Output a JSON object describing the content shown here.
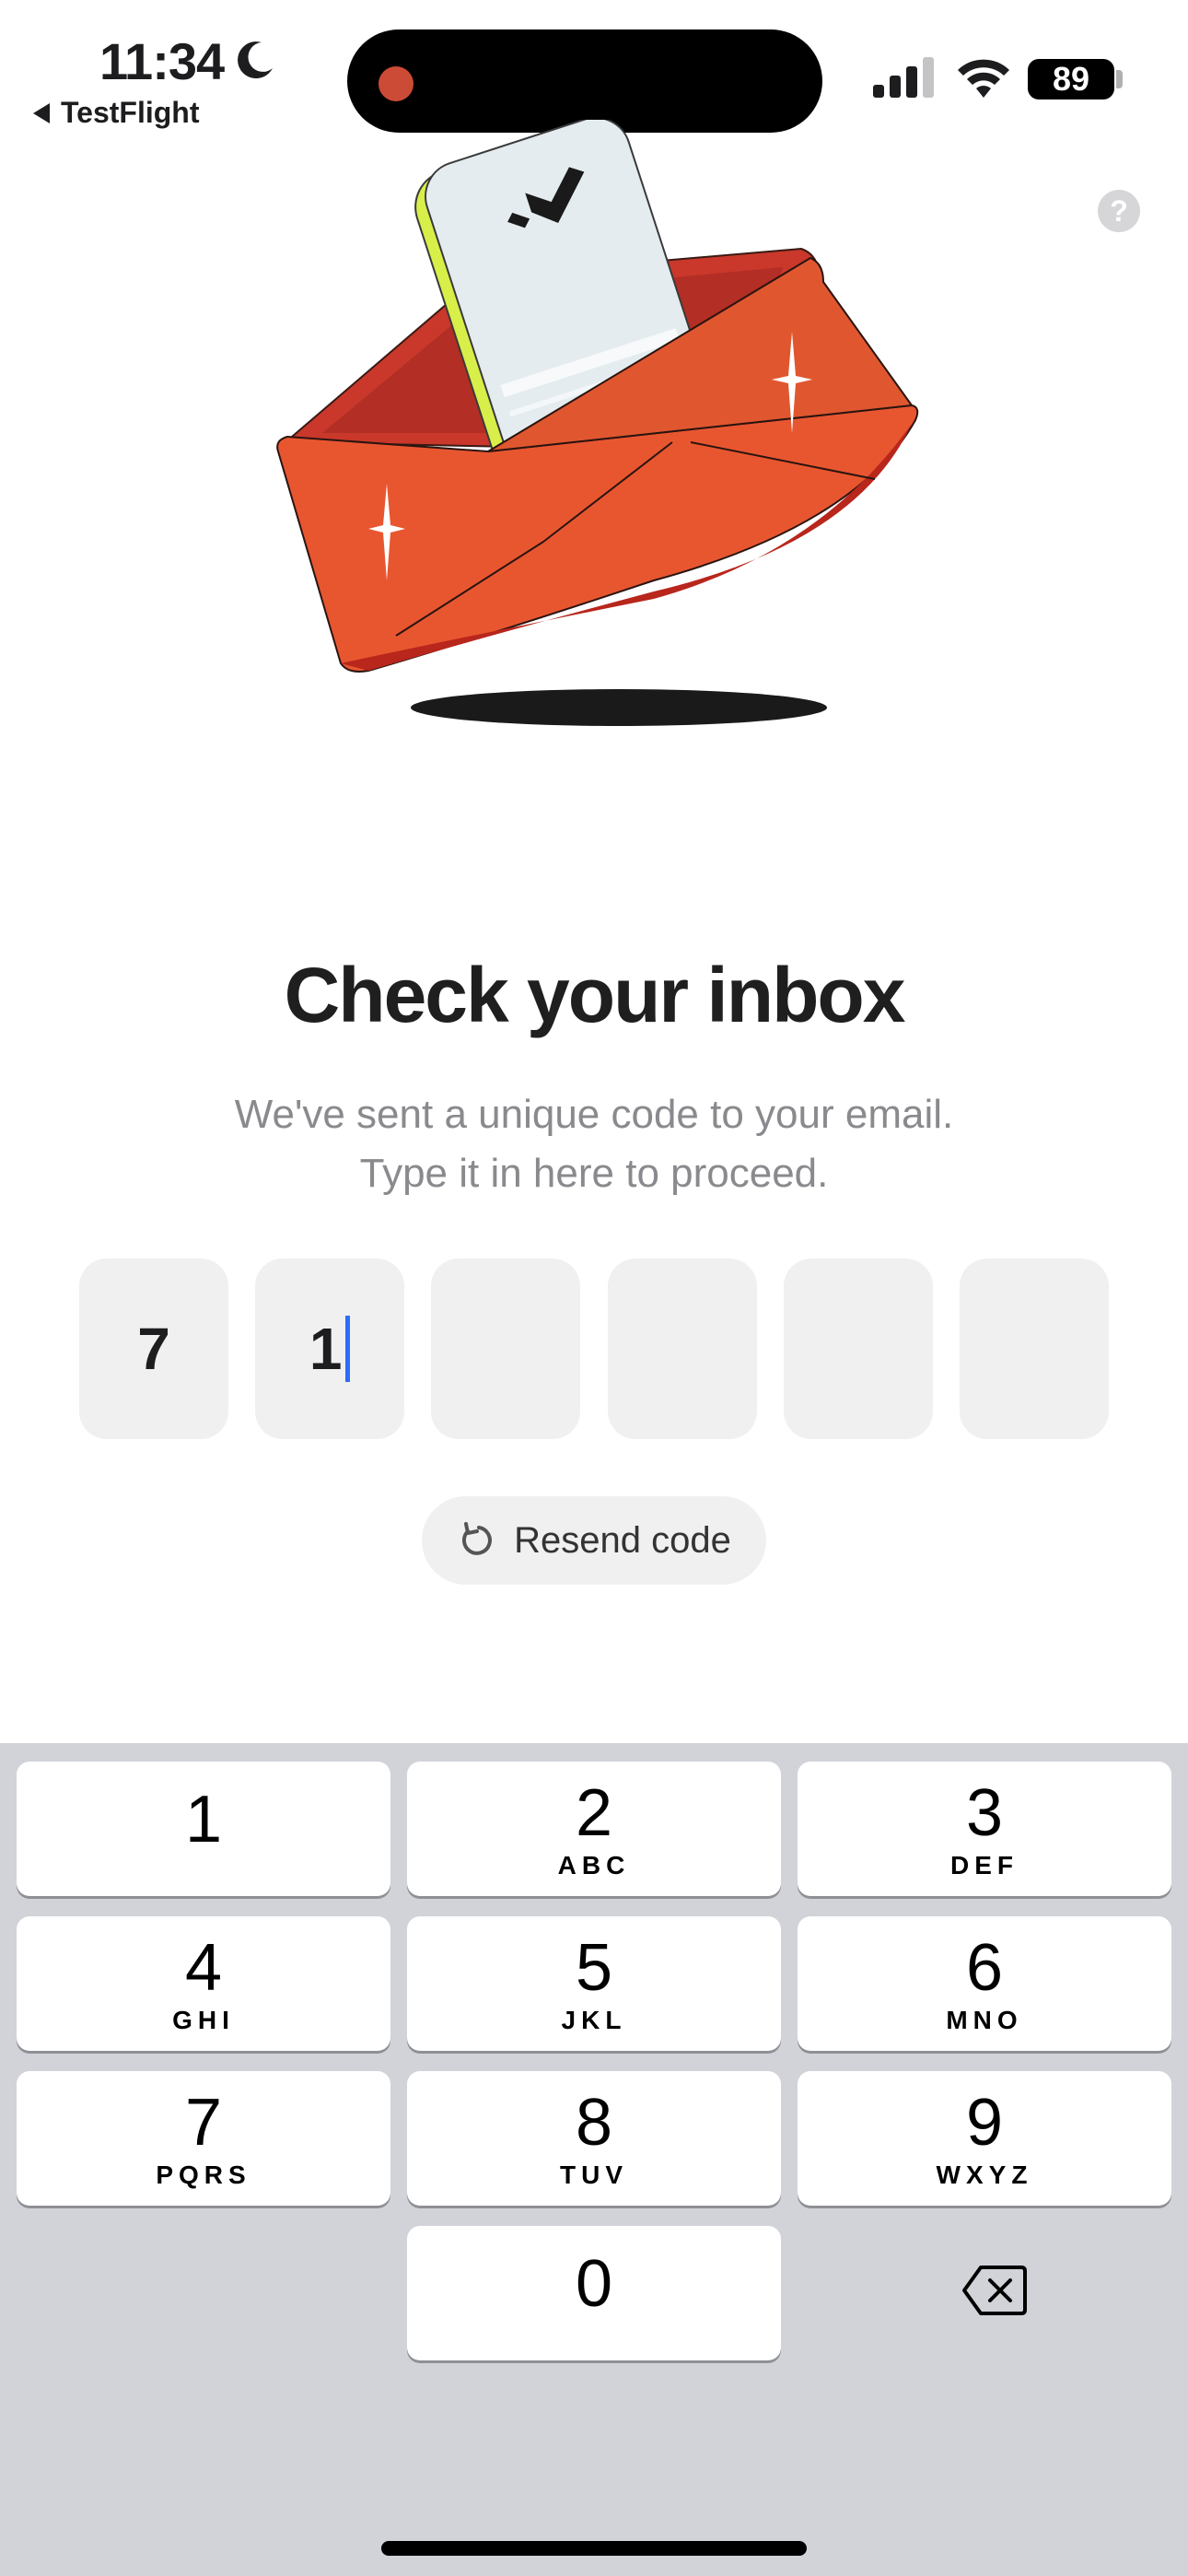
{
  "status_bar": {
    "time": "11:34",
    "back_app": "TestFlight",
    "battery": "89"
  },
  "help_label": "?",
  "title": "Check your inbox",
  "subtitle_line1": "We've sent a unique code to your email.",
  "subtitle_line2": "Type it in here to proceed.",
  "code_digits": [
    "7",
    "1",
    "",
    "",
    "",
    ""
  ],
  "resend_label": "Resend code",
  "keyboard": {
    "keys": [
      {
        "digit": "1",
        "letters": ""
      },
      {
        "digit": "2",
        "letters": "ABC"
      },
      {
        "digit": "3",
        "letters": "DEF"
      },
      {
        "digit": "4",
        "letters": "GHI"
      },
      {
        "digit": "5",
        "letters": "JKL"
      },
      {
        "digit": "6",
        "letters": "MNO"
      },
      {
        "digit": "7",
        "letters": "PQRS"
      },
      {
        "digit": "8",
        "letters": "TUV"
      },
      {
        "digit": "9",
        "letters": "WXYZ"
      },
      {
        "digit": "0",
        "letters": ""
      }
    ]
  },
  "colors": {
    "accent_caret": "#2f6bff",
    "envelope": "#e85630",
    "keyboard_bg": "#d1d3d9"
  }
}
